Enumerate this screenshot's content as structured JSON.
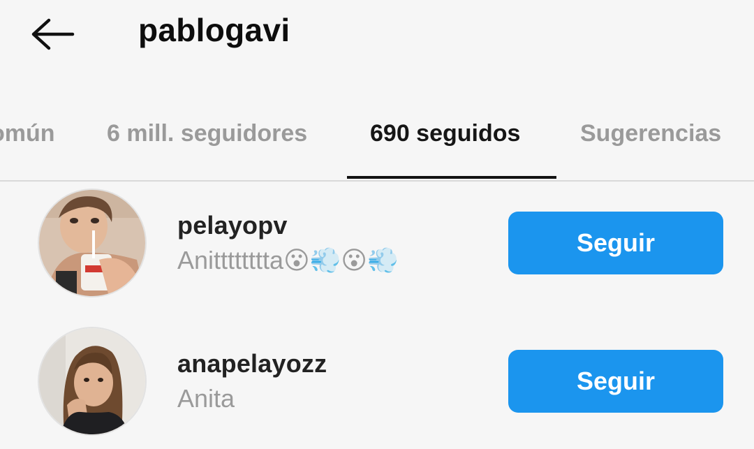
{
  "header": {
    "back_icon": "arrow-left-icon",
    "title": "pablogavi"
  },
  "tabs": [
    {
      "label": "omún",
      "active": false
    },
    {
      "label": "6 mill. seguidores",
      "active": false
    },
    {
      "label": "690 seguidos",
      "active": true
    },
    {
      "label": "Sugerencias",
      "active": false
    }
  ],
  "accounts": [
    {
      "username": "pelayopv",
      "full_name": "Anitttttttta😮💨😮💨",
      "button_label": "Seguir"
    },
    {
      "username": "anapelayozz",
      "full_name": "Anita",
      "button_label": "Seguir"
    }
  ],
  "colors": {
    "accent": "#1b95ee",
    "background": "#f6f6f6",
    "muted_text": "#9a9a9a"
  }
}
